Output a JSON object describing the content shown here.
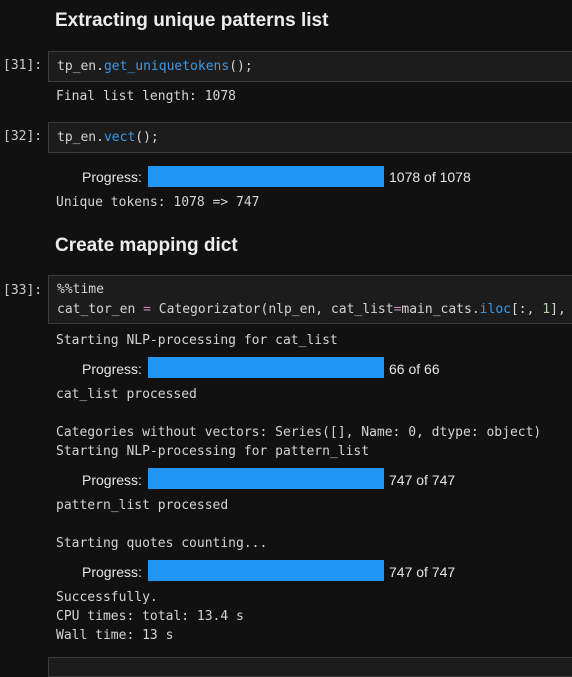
{
  "sections": {
    "extract_heading": "Extracting unique patterns list",
    "mapping_heading": "Create mapping dict"
  },
  "cells": {
    "c31": {
      "prompt": "[31]:",
      "code": {
        "obj": "tp_en.",
        "fn": "get_uniquetokens",
        "tail": "();"
      },
      "output": "Final list length: 1078"
    },
    "c32": {
      "prompt": "[32]:",
      "code": {
        "obj": "tp_en.",
        "fn": "vect",
        "tail": "();"
      },
      "progress": {
        "label": "Progress:",
        "count": "1078 of 1078",
        "fraction": 1.0
      },
      "output": "Unique tokens: 1078 => 747"
    },
    "c33": {
      "prompt": "[33]:",
      "code_line1": "%%time",
      "code_line2": {
        "a": "cat_tor_en ",
        "eq": "=",
        "b": " Categorizator(nlp_en, cat_list",
        "eq2": "=",
        "c": "main_cats.",
        "fn": "iloc",
        "d": "[:, ",
        "num": "1",
        "e": "],"
      },
      "out1": "Starting NLP-processing for cat_list",
      "progress1": {
        "label": "Progress:",
        "count": "66 of 66",
        "fraction": 1.0
      },
      "out2": "cat_list processed",
      "out3": "Categories without vectors: Series([], Name: 0, dtype: object)",
      "out4": "Starting NLP-processing for pattern_list",
      "progress2": {
        "label": "Progress:",
        "count": "747 of 747",
        "fraction": 1.0
      },
      "out5": "pattern_list processed",
      "out6": "Starting quotes counting...",
      "progress3": {
        "label": "Progress:",
        "count": "747 of 747",
        "fraction": 1.0
      },
      "out7": "Successfully.",
      "out8": "CPU times: total: 13.4 s",
      "out9": "Wall time: 13 s"
    }
  },
  "colors": {
    "progress_fill": "#2196f3",
    "function": "#3e9ae6",
    "background": "#111111"
  }
}
